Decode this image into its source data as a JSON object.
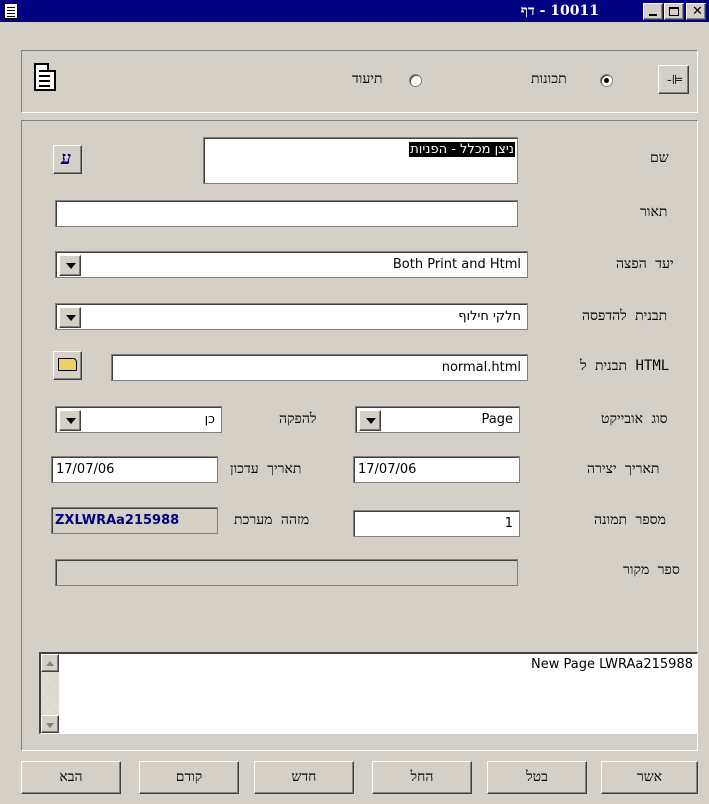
{
  "window": {
    "title": "10011 - דף"
  },
  "header": {
    "radio_properties_label": "תכונות",
    "radio_documentation_label": "תיעוד"
  },
  "form": {
    "name_label": "שם",
    "name_value": "ניצן מכלל - הפניות",
    "description_label": "תאור",
    "description_value": "",
    "distribution_target_label": "יעד הפצה",
    "distribution_target_value": "Both Print and Html",
    "print_template_label": "תבנית להדפסה",
    "print_template_value": "חלקי חילוף",
    "html_template_label": "תבנית ל HTML",
    "html_template_value": "normal.html",
    "object_type_label": "סוג אובייקט",
    "object_type_value": "Page",
    "production_label": "להפקה",
    "production_value": "כן",
    "creation_date_label": "תאריך יצירה",
    "creation_date_value": "17/07/06",
    "update_date_label": "תאריך עדכון",
    "update_date_value": "17/07/06",
    "image_number_label": "מספר תמונה",
    "image_number_value": "1",
    "system_id_label": "מזהה מערכת",
    "system_id_value": "ZXLWRAa215988",
    "source_book_label": "ספר מקור",
    "source_book_value": ""
  },
  "memo": {
    "text": "New Page LWRAa215988"
  },
  "buttons": {
    "confirm": "אשר",
    "cancel": "בטל",
    "apply": "החל",
    "new": "חדש",
    "previous": "קודם",
    "next": "הבא"
  },
  "colors": {
    "titlebar": "#000080",
    "face": "#d4d0c8",
    "system_id_text": "#000080"
  }
}
